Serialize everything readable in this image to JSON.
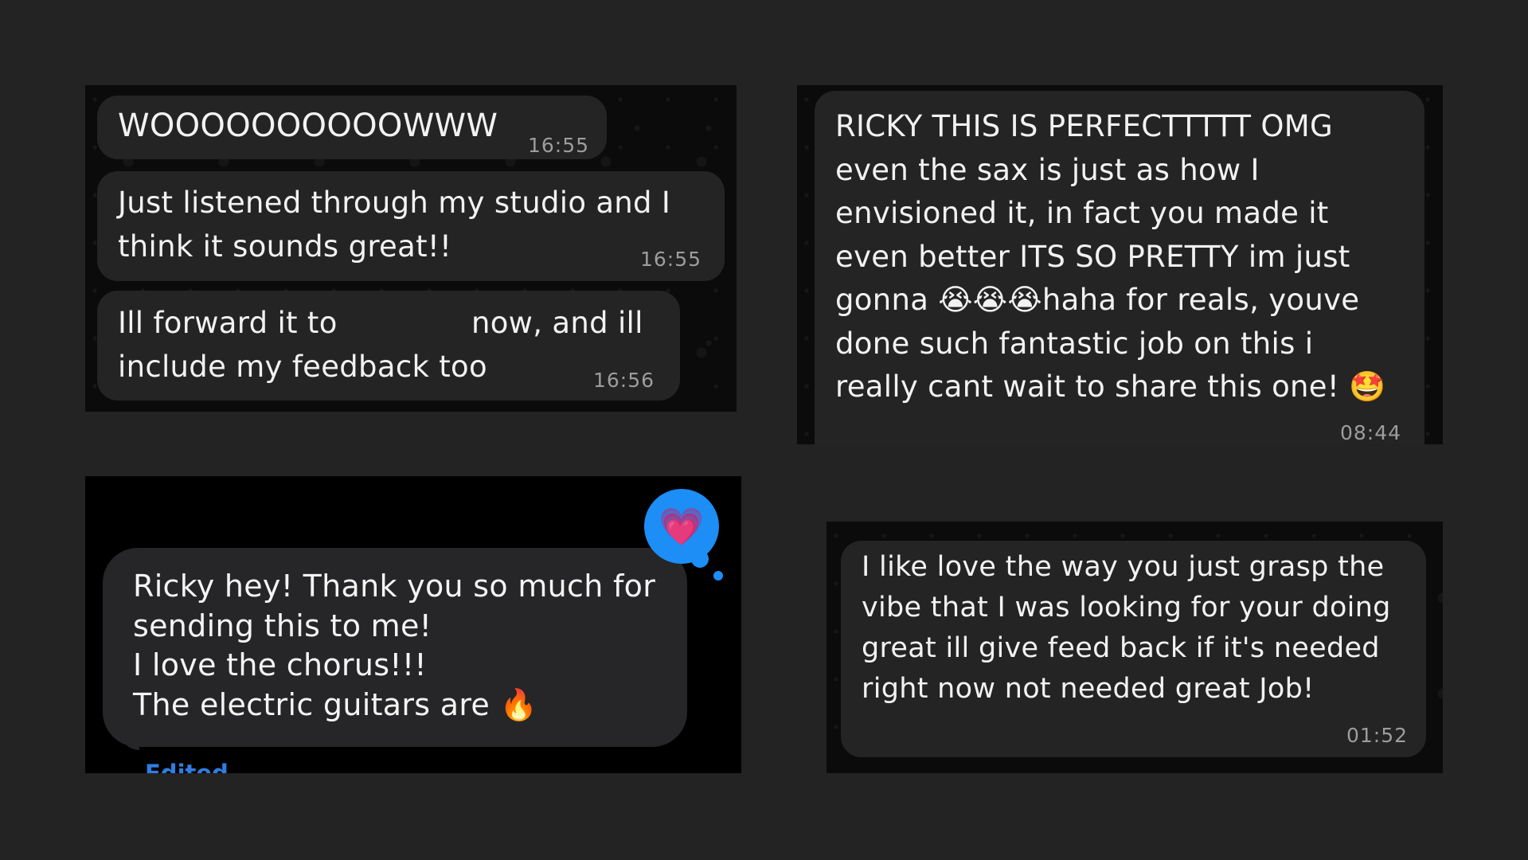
{
  "panel1": {
    "msg1": {
      "text": "WOOOOOOOOOOWWW",
      "time": "16:55"
    },
    "msg2": {
      "text": "Just listened through my studio and I\nthink it sounds great!!",
      "time": "16:55"
    },
    "msg3": {
      "line1a": "Ill forward it to",
      "line1b": "now, and ill",
      "line2": "include my feedback too",
      "time": "16:56"
    }
  },
  "panel2": {
    "msg": {
      "lines": [
        "RICKY THIS IS PERFECTTTTT OMG",
        "even the sax is just as how I",
        "envisioned it, in fact you made it",
        "even better ITS SO PRETTY im just",
        "gonna 😭😭😭haha for reals, youve",
        "done such fantastic job on this i",
        "really cant wait to share this one! 🤩"
      ],
      "time": "08:44"
    }
  },
  "panel3": {
    "msg": {
      "lines": [
        "Ricky hey! Thank you so much for",
        "sending this to me!",
        "I love the chorus!!!",
        "The electric guitars are 🔥"
      ]
    },
    "reaction": "💗",
    "edited_label": "Edited"
  },
  "panel4": {
    "msg": {
      "lines": [
        "I like love the way you just grasp the",
        "vibe that I was looking for your doing",
        "great ill give feed back if it's needed",
        "right now not needed great Job!"
      ],
      "time": "01:52"
    }
  },
  "colors": {
    "background": "#232323",
    "bubble": "#242424",
    "imessage_bubble": "#262628",
    "accent_blue": "#1c8ef6",
    "timestamp": "#9d9d9d"
  }
}
